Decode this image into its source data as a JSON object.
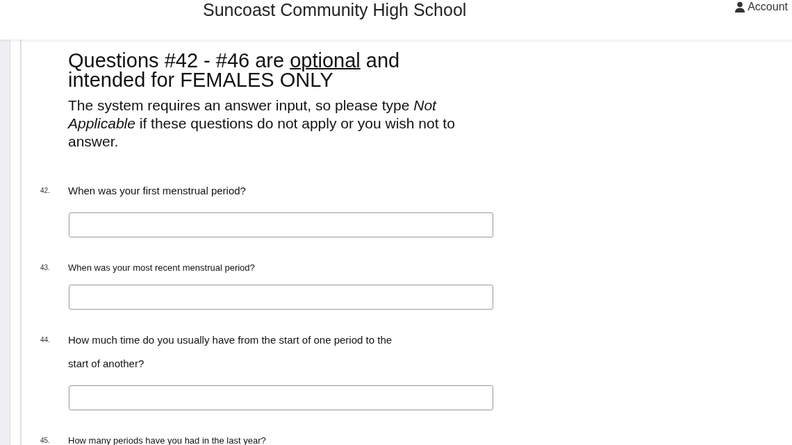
{
  "header": {
    "title": "Suncoast Community High School",
    "account": "Account"
  },
  "heading": [
    {
      "text": "Questions #42 - #46 are ",
      "underlined": false
    },
    {
      "text": "optional",
      "underlined": true
    },
    {
      "text": " and intended for FEMALES ONLY",
      "underlined": false
    }
  ],
  "intro": "The system requires an answer input, so please type *Not Applicable* if these questions do not apply or you wish not to answer.",
  "questions": [
    {
      "number": "42.",
      "text": "When was your first menstrual period?",
      "kind": "large"
    },
    {
      "number": "43.",
      "text": "When was your most recent menstrual period?",
      "kind": "small"
    },
    {
      "number": "44.",
      "text": "How much time do you usually have from the start of one period to the start of another?",
      "kind": "large"
    },
    {
      "number": "45.",
      "text": "How many periods have you had in the last year?",
      "kind": "small"
    }
  ]
}
